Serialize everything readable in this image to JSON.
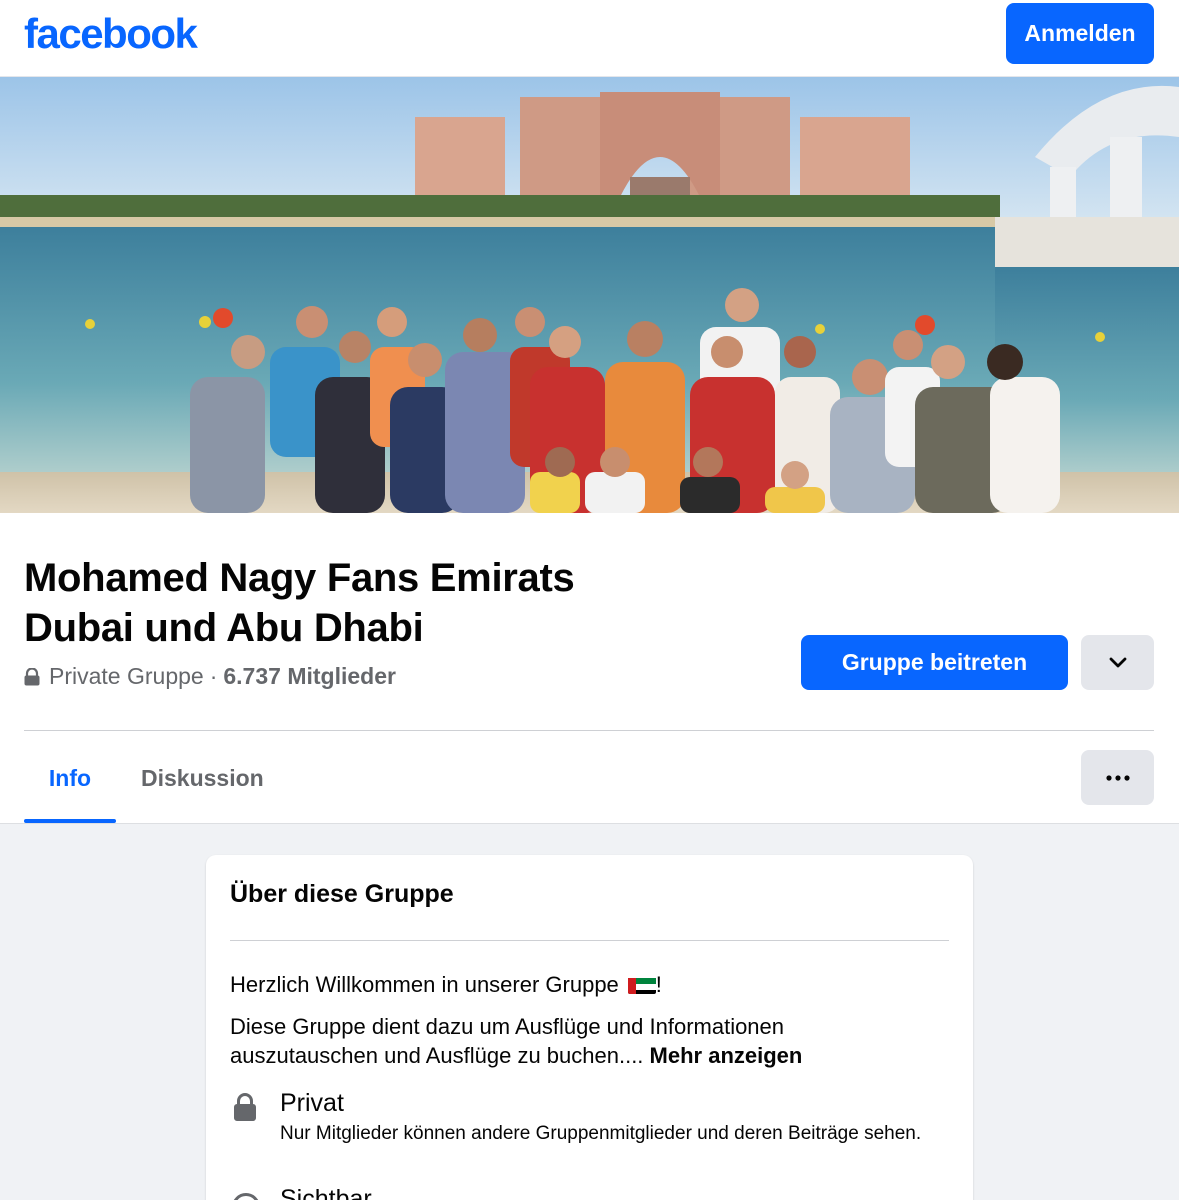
{
  "topbar": {
    "logo": "facebook",
    "login_label": "Anmelden"
  },
  "cover": {
    "description_icon": "cover-photo"
  },
  "group": {
    "name": "Mohamed Nagy Fans Emirats Dubai und Abu Dhabi",
    "privacy": "Private Gruppe",
    "separator": "·",
    "members": "6.737 Mitglieder",
    "join_label": "Gruppe beitreten"
  },
  "tabs": [
    {
      "label": "Info",
      "active": true
    },
    {
      "label": "Diskussion",
      "active": false
    }
  ],
  "about": {
    "title": "Über diese Gruppe",
    "welcome": "Herzlich Willkommen in unserer Gruppe",
    "welcome_suffix": "!",
    "description": "Diese Gruppe dient dazu um Ausflüge und Informationen auszutauschen und Ausflüge zu buchen....",
    "more_label": "Mehr anzeigen",
    "private_title": "Privat",
    "private_text": "Nur Mitglieder können andere Gruppenmitglieder und deren Beiträge sehen.",
    "visible_title": "Sichtbar"
  },
  "colors": {
    "brand": "#0866ff",
    "secondary_button": "#e4e6eb",
    "muted_text": "#65676b",
    "background": "#f0f2f5"
  }
}
